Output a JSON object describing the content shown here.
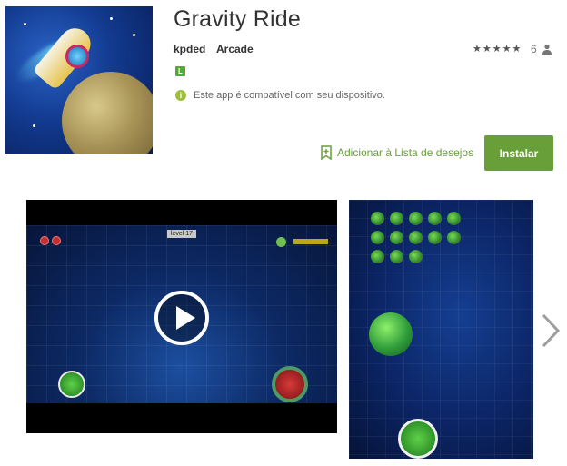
{
  "app": {
    "title": "Gravity Ride",
    "developer": "kpded",
    "category": "Arcade",
    "content_rating": "L",
    "compatibility": "Este app é compatível com seu dispositivo.",
    "stars": "★★★★★",
    "rating_count": "6"
  },
  "actions": {
    "wishlist_label": "Adicionar à Lista de desejos",
    "install_label": "Instalar"
  },
  "screenshots": {
    "level_label": "level 17"
  },
  "icons": {
    "info": "info-icon",
    "person": "person-icon",
    "bookmark": "bookmark-add-icon",
    "play": "play-icon",
    "next": "chevron-right-icon"
  },
  "colors": {
    "accent": "#689f38",
    "rating_badge": "#55aa33"
  }
}
